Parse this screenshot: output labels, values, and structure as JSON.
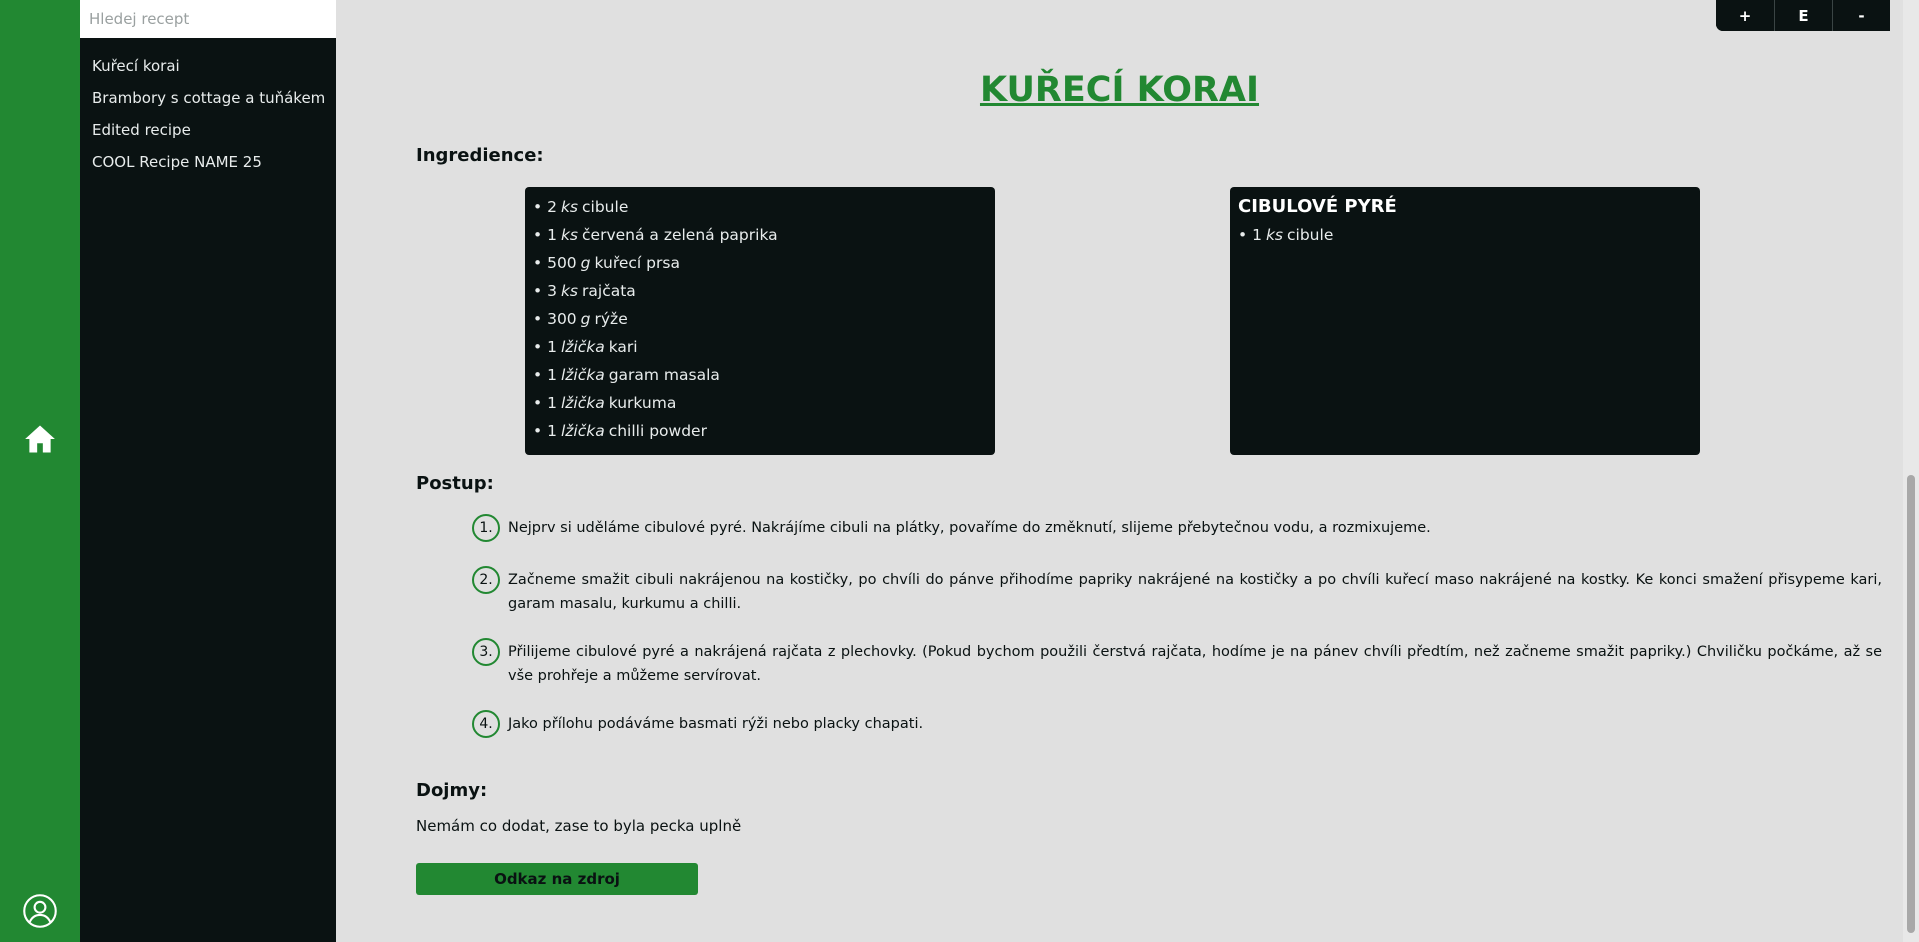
{
  "search": {
    "placeholder": "Hledej recept"
  },
  "sidebar": {
    "recipes": [
      "Kuřecí korai",
      "Brambory s cottage a tuňákem",
      "Edited recipe",
      "COOL Recipe NAME 25"
    ]
  },
  "controls": {
    "plus": "+",
    "edit": "E",
    "minus": "-"
  },
  "recipe": {
    "title": "KUŘECÍ KORAI",
    "ingredients_heading": "Ingredience:",
    "ingredients": [
      {
        "amount": "2",
        "unit": "ks",
        "name": "cibule"
      },
      {
        "amount": "1",
        "unit": "ks",
        "name": "červená a zelená paprika"
      },
      {
        "amount": "500",
        "unit": "g",
        "name": "kuřecí prsa"
      },
      {
        "amount": "3",
        "unit": "ks",
        "name": "rajčata"
      },
      {
        "amount": "300",
        "unit": "g",
        "name": "rýže"
      },
      {
        "amount": "1",
        "unit": "lžička",
        "name": "kari"
      },
      {
        "amount": "1",
        "unit": "lžička",
        "name": "garam masala"
      },
      {
        "amount": "1",
        "unit": "lžička",
        "name": "kurkuma"
      },
      {
        "amount": "1",
        "unit": "lžička",
        "name": "chilli powder"
      }
    ],
    "sub_group": {
      "title": "CIBULOVÉ PYRÉ",
      "ingredients": [
        {
          "amount": "1",
          "unit": "ks",
          "name": "cibule"
        }
      ]
    },
    "steps_heading": "Postup:",
    "steps": [
      {
        "num": "1.",
        "text": "Nejprv si uděláme cibulové pyré. Nakrájíme cibuli na plátky, povaříme do změknutí, slijeme přebytečnou vodu, a rozmixujeme."
      },
      {
        "num": "2.",
        "text": "Začneme smažit cibuli nakrájenou na kostičky, po chvíli do pánve přihodíme papriky nakrájené na kostičky a po chvíli kuřecí maso nakrájené na kostky. Ke konci smažení přisypeme kari, garam masalu, kurkumu a chilli."
      },
      {
        "num": "3.",
        "text": "Přilijeme cibulové pyré a nakrájená rajčata z plechovky. (Pokud bychom použili čerstvá rajčata, hodíme je na pánev chvíli předtím, než začneme smažit papriky.) Chviličku počkáme, až se vše prohřeje a můžeme servírovat."
      },
      {
        "num": "4.",
        "text": "Jako přílohu podáváme basmati rýži nebo placky chapati."
      }
    ],
    "impressions_heading": "Dojmy:",
    "impressions": "Nemám co dodat, zase to byla pecka uplně",
    "source_button": "Odkaz na zdroj"
  },
  "icons": {
    "home": "home-icon",
    "user": "user-icon"
  },
  "colors": {
    "accent": "#228832",
    "dark": "#0a1212",
    "background": "#e0e0e0"
  }
}
